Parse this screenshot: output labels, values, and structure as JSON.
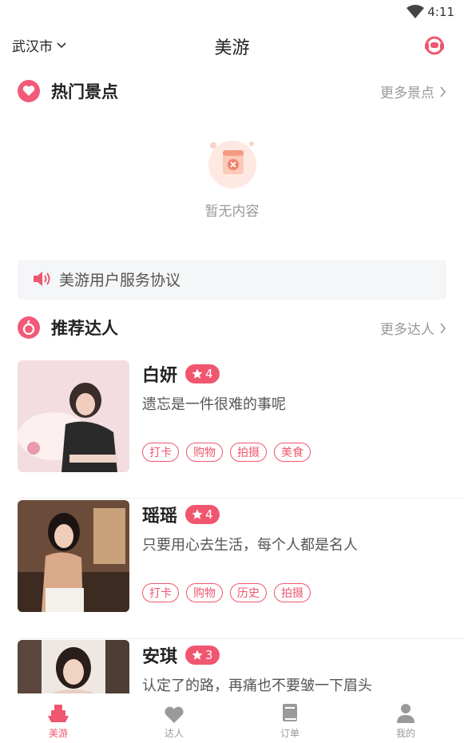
{
  "status_bar": {
    "time": "4:11"
  },
  "header": {
    "city": "武汉市",
    "title": "美游"
  },
  "hot_spots": {
    "title": "热门景点",
    "more": "更多景点",
    "empty_text": "暂无内容"
  },
  "notice": {
    "text": "美游用户服务协议"
  },
  "experts": {
    "title": "推荐达人",
    "more": "更多达人",
    "items": [
      {
        "name": "白妍",
        "rating": "4",
        "bio": "遗忘是一件很难的事呢",
        "tags": [
          "打卡",
          "购物",
          "拍摄",
          "美食"
        ]
      },
      {
        "name": "瑶瑶",
        "rating": "4",
        "bio": "只要用心去生活，每个人都是名人",
        "tags": [
          "打卡",
          "购物",
          "历史",
          "拍摄"
        ]
      },
      {
        "name": "安琪",
        "rating": "3",
        "bio": "认定了的路，再痛也不要皱一下眉头",
        "tags": []
      }
    ]
  },
  "tabbar": {
    "items": [
      {
        "label": "美游",
        "icon": "ship-icon",
        "active": true
      },
      {
        "label": "达人",
        "icon": "heart-icon",
        "active": false
      },
      {
        "label": "订单",
        "icon": "book-icon",
        "active": false
      },
      {
        "label": "我的",
        "icon": "user-icon",
        "active": false
      }
    ]
  },
  "colors": {
    "accent": "#f0566f",
    "muted": "#999999",
    "notice_bg": "#f5f6f8"
  }
}
